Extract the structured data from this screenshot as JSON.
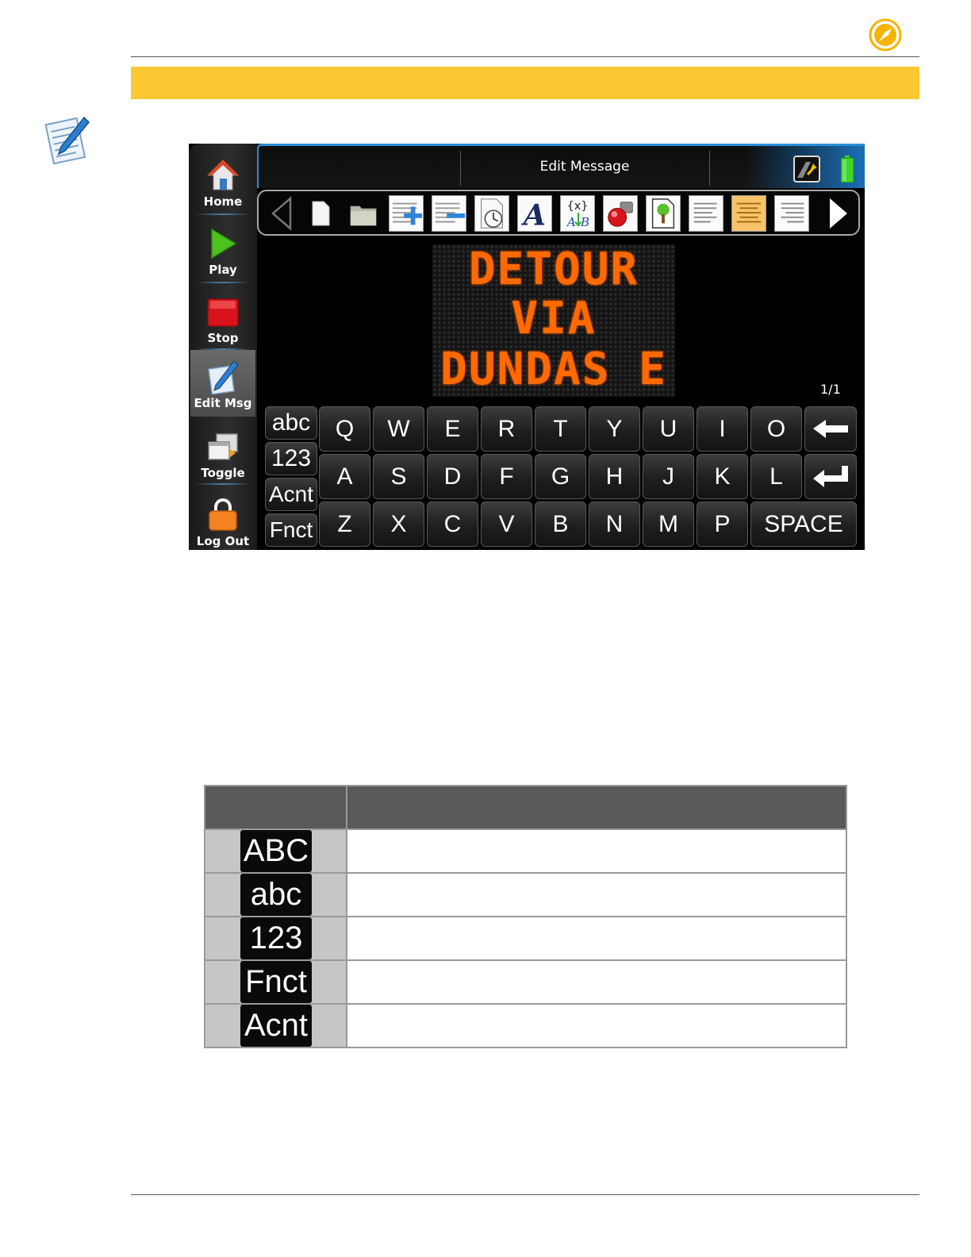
{
  "device": {
    "sidebar": [
      {
        "label": "Home",
        "icon": "home-icon"
      },
      {
        "label": "Play",
        "icon": "play-icon"
      },
      {
        "label": "Stop",
        "icon": "stop-icon"
      },
      {
        "label": "Edit Msg",
        "icon": "edit-pencil-icon",
        "active": true
      },
      {
        "label": "Toggle",
        "icon": "toggle-windows-icon"
      },
      {
        "label": "Log Out",
        "icon": "padlock-icon"
      }
    ],
    "title": "Edit Message",
    "message": {
      "lines": [
        "DETOUR",
        "VIA",
        "DUNDAS E"
      ],
      "color": "#ff6a00"
    },
    "page_indicator": "1/1",
    "keyboard": {
      "mode_keys": [
        "abc",
        "123",
        "Acnt",
        "Fnct"
      ],
      "row1": [
        "Q",
        "W",
        "E",
        "R",
        "T",
        "Y",
        "U",
        "I",
        "O"
      ],
      "row2": [
        "A",
        "S",
        "D",
        "F",
        "G",
        "H",
        "J",
        "K",
        "L"
      ],
      "row3": [
        "Z",
        "X",
        "C",
        "V",
        "B",
        "N",
        "M",
        "P"
      ],
      "space": "SPACE"
    }
  },
  "key_table": {
    "rows": [
      {
        "key": "ABC",
        "description": ""
      },
      {
        "key": "abc",
        "description": ""
      },
      {
        "key": "123",
        "description": ""
      },
      {
        "key": "Fnct",
        "description": ""
      },
      {
        "key": "Acnt",
        "description": ""
      }
    ]
  },
  "colors": {
    "banner": "#fcc832",
    "accent_blue": "#2a8fd8",
    "highlight_button": "#f6c26a"
  }
}
